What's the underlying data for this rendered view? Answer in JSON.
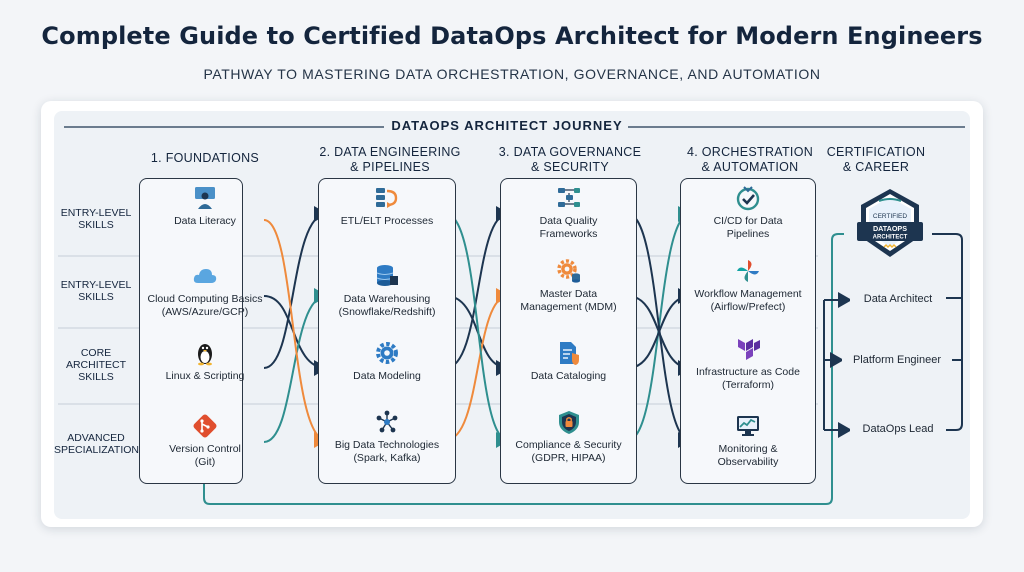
{
  "title": "Complete Guide to Certified DataOps Architect for Modern Engineers",
  "subtitle": "PATHWAY TO MASTERING DATA ORCHESTRATION, GOVERNANCE, AND AUTOMATION",
  "journey_title": "DATAOPS ARCHITECT JOURNEY",
  "columns": [
    {
      "title": "1. FOUNDATIONS",
      "items": [
        {
          "label": "Data Literacy",
          "icon": "person-presenting-icon"
        },
        {
          "label": "Cloud Computing Basics\n(AWS/Azure/GCP)",
          "icon": "cloud-icon"
        },
        {
          "label": "Linux & Scripting",
          "icon": "penguin-icon"
        },
        {
          "label": "Version Control\n(Git)",
          "icon": "git-icon"
        }
      ]
    },
    {
      "title": "2. DATA ENGINEERING\n& PIPELINES",
      "items": [
        {
          "label": "ETL/ELT Processes",
          "icon": "transform-icon"
        },
        {
          "label": "Data Warehousing\n(Snowflake/Redshift)",
          "icon": "database-icon"
        },
        {
          "label": "Data Modeling",
          "icon": "gear-icon"
        },
        {
          "label": "Big Data Technologies\n(Spark, Kafka)",
          "icon": "network-nodes-icon"
        }
      ]
    },
    {
      "title": "3. DATA GOVERNANCE\n& SECURITY",
      "items": [
        {
          "label": "Data Quality\nFrameworks",
          "icon": "flowchart-icon"
        },
        {
          "label": "Master Data\nManagement (MDM)",
          "icon": "gear-database-icon"
        },
        {
          "label": "Data Cataloging",
          "icon": "document-shield-icon"
        },
        {
          "label": "Compliance & Security\n(GDPR, HIPAA)",
          "icon": "shield-lock-icon"
        }
      ]
    },
    {
      "title": "4. ORCHESTRATION\n& AUTOMATION",
      "items": [
        {
          "label": "CI/CD for Data\nPipelines",
          "icon": "cicd-check-icon"
        },
        {
          "label": "Workflow Management\n(Airflow/Prefect)",
          "icon": "pinwheel-icon"
        },
        {
          "label": "Infrastructure as Code\n(Terraform)",
          "icon": "terraform-icon"
        },
        {
          "label": "Monitoring &\nObservability",
          "icon": "monitor-chart-icon"
        }
      ]
    }
  ],
  "career": {
    "title": "CERTIFICATION\n& CAREER",
    "badge": {
      "top": "CERTIFIED",
      "main": "DATAOPS\nARCHITECT"
    },
    "roles": [
      "Data Architect",
      "Platform Engineer",
      "DataOps Lead"
    ]
  },
  "row_labels": [
    "ENTRY-LEVEL\nSKILLS",
    "ENTRY-LEVEL\nSKILLS",
    "CORE\nARCHITECT\nSKILLS",
    "ADVANCED\nSPECIALIZATION"
  ],
  "colors": {
    "navy": "#14253d",
    "teal": "#2f8f8f",
    "orange": "#ef8a3c",
    "blue": "#2e7bc4",
    "red": "#e04e2e"
  }
}
